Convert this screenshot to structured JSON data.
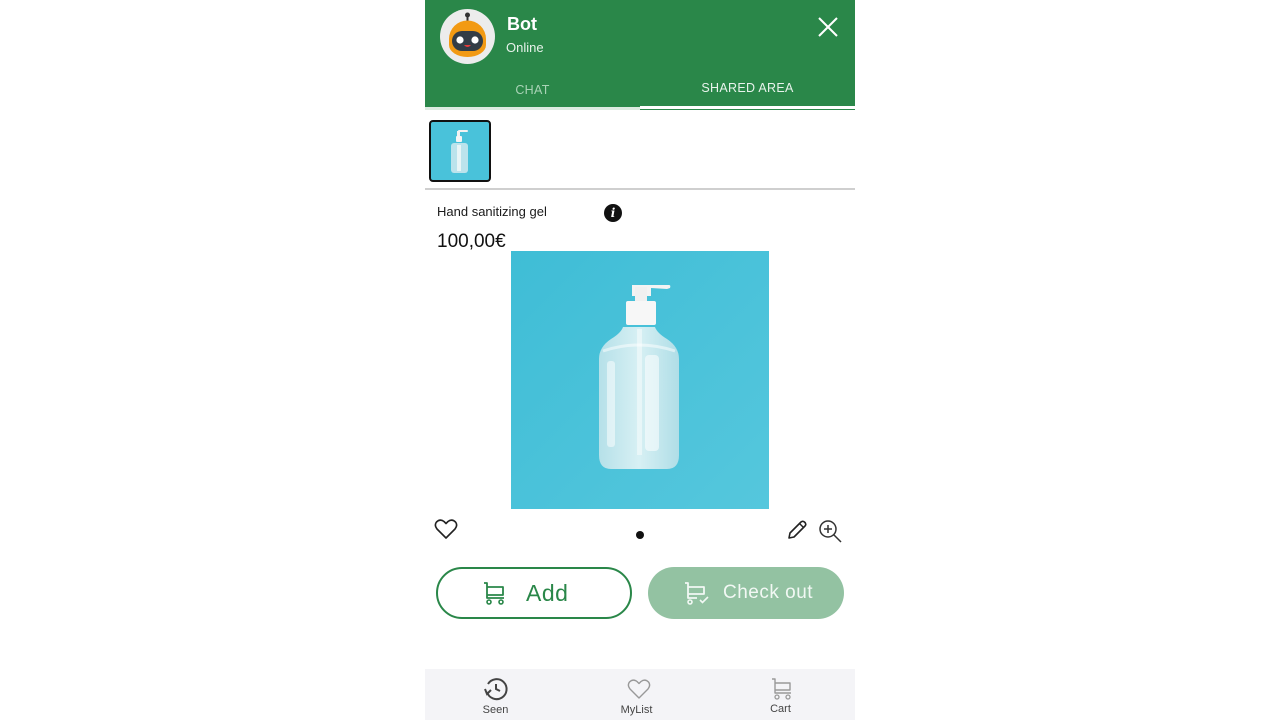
{
  "header": {
    "bot_name": "Bot",
    "bot_status": "Online",
    "close_icon": "close-icon",
    "avatar_icon": "robot-avatar-icon"
  },
  "tabs": [
    {
      "label": "CHAT",
      "active": false
    },
    {
      "label": "SHARED AREA",
      "active": true
    }
  ],
  "shared_items": [
    {
      "name": "Hand sanitizing gel",
      "selected": true
    }
  ],
  "product": {
    "name": "Hand sanitizing gel",
    "price": "100,00€",
    "info_icon": "i",
    "image_count": 1,
    "current_image": 1
  },
  "actions": {
    "add_label": "Add",
    "checkout_label": "Check out"
  },
  "bottom_nav": [
    {
      "label": "Seen",
      "icon": "history-icon"
    },
    {
      "label": "MyList",
      "icon": "heart-icon"
    },
    {
      "label": "Cart",
      "icon": "cart-icon"
    }
  ],
  "colors": {
    "brand_green": "#2a8749",
    "checkout_disabled": "#93c2a2",
    "product_bg": "#4cc3db",
    "nav_bg": "#f4f4f7"
  }
}
